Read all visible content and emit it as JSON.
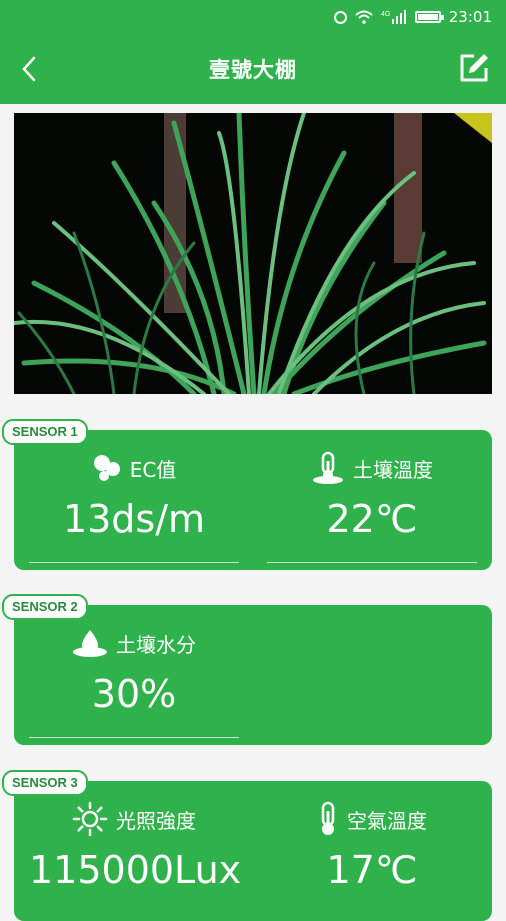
{
  "status_bar": {
    "time": "23:01",
    "battery_level": 0.9,
    "icons": [
      "alarm-icon",
      "wifi-icon",
      "signal-icon",
      "battery-icon"
    ]
  },
  "header": {
    "title": "壹號大棚",
    "back_icon": "chevron-left-icon",
    "edit_icon": "edit-icon"
  },
  "photo": {
    "description_icon": "greenhouse-photo"
  },
  "sensors": [
    {
      "tag": "SENSOR 1",
      "metrics": [
        {
          "label": "EC值",
          "value": "13ds/m",
          "icon": "ec-icon"
        },
        {
          "label": "土壤溫度",
          "value": "22℃",
          "icon": "soil-thermometer-icon"
        }
      ]
    },
    {
      "tag": "SENSOR 2",
      "metrics": [
        {
          "label": "土壤水分",
          "value": "30%",
          "icon": "soil-moisture-icon"
        }
      ]
    },
    {
      "tag": "SENSOR 3",
      "metrics": [
        {
          "label": "光照強度",
          "value": "115000Lux",
          "icon": "sun-icon"
        },
        {
          "label": "空氣溫度",
          "value": "17℃",
          "icon": "thermometer-icon"
        }
      ]
    }
  ],
  "colors": {
    "primary": "#2fb24b",
    "background": "#f4f4f4"
  }
}
